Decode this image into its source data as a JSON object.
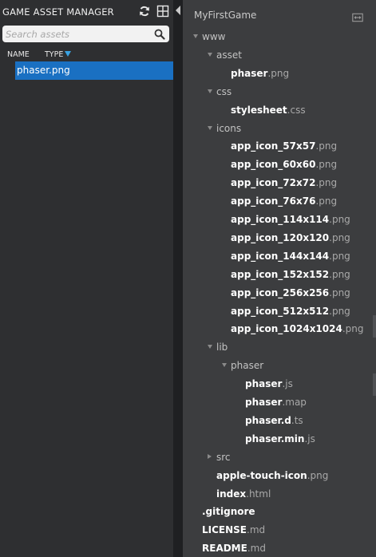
{
  "left_panel": {
    "title": "GAME ASSET MANAGER",
    "search": {
      "placeholder": "Search assets",
      "value": ""
    },
    "columns": {
      "name": "NAME",
      "type": "TYPE"
    },
    "assets": [
      {
        "label": "phaser.png",
        "selected": true
      }
    ],
    "accent_color": "#1a70c2"
  },
  "project": {
    "title": "MyFirstGame",
    "tree": [
      {
        "type": "folder",
        "name": "www",
        "expanded": true
      },
      {
        "type": "folder",
        "name": "asset",
        "expanded": true
      },
      {
        "type": "file",
        "name": "phaser",
        "ext": ".png"
      },
      {
        "type": "folder",
        "name": "css",
        "expanded": true
      },
      {
        "type": "file",
        "name": "stylesheet",
        "ext": ".css"
      },
      {
        "type": "folder",
        "name": "icons",
        "expanded": true
      },
      {
        "type": "file",
        "name": "app_icon_57x57",
        "ext": ".png"
      },
      {
        "type": "file",
        "name": "app_icon_60x60",
        "ext": ".png"
      },
      {
        "type": "file",
        "name": "app_icon_72x72",
        "ext": ".png"
      },
      {
        "type": "file",
        "name": "app_icon_76x76",
        "ext": ".png"
      },
      {
        "type": "file",
        "name": "app_icon_114x114",
        "ext": ".png"
      },
      {
        "type": "file",
        "name": "app_icon_120x120",
        "ext": ".png"
      },
      {
        "type": "file",
        "name": "app_icon_144x144",
        "ext": ".png"
      },
      {
        "type": "file",
        "name": "app_icon_152x152",
        "ext": ".png"
      },
      {
        "type": "file",
        "name": "app_icon_256x256",
        "ext": ".png"
      },
      {
        "type": "file",
        "name": "app_icon_512x512",
        "ext": ".png"
      },
      {
        "type": "file",
        "name": "app_icon_1024x1024",
        "ext": ".png"
      },
      {
        "type": "folder",
        "name": "lib",
        "expanded": true
      },
      {
        "type": "folder",
        "name": "phaser",
        "expanded": true
      },
      {
        "type": "file",
        "name": "phaser",
        "ext": ".js"
      },
      {
        "type": "file",
        "name": "phaser",
        "ext": ".map"
      },
      {
        "type": "file",
        "name": "phaser.d",
        "ext": ".ts"
      },
      {
        "type": "file",
        "name": "phaser.min",
        "ext": ".js"
      },
      {
        "type": "folder",
        "name": "src",
        "expanded": false
      },
      {
        "type": "file",
        "name": "apple-touch-icon",
        "ext": ".png"
      },
      {
        "type": "file",
        "name": "index",
        "ext": ".html"
      },
      {
        "type": "file",
        "name": ".gitignore",
        "ext": ""
      },
      {
        "type": "file",
        "name": "LICENSE",
        "ext": ".md"
      },
      {
        "type": "file",
        "name": "README",
        "ext": ".md"
      }
    ]
  }
}
